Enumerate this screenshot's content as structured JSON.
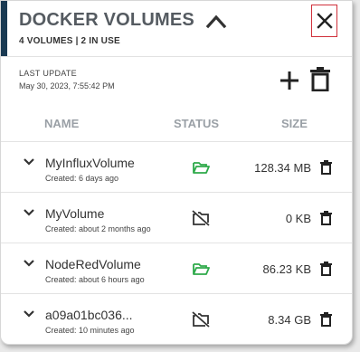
{
  "colors": {
    "accent": "#1a3a52",
    "status_available": "#2eaa4a",
    "status_unavailable": "#333333",
    "close_border": "#d0303a"
  },
  "header": {
    "title": "DOCKER VOLUMES",
    "subtitle": "4 VOLUMES | 2 IN USE",
    "collapse_icon": "chevron-up-icon",
    "close_icon": "close-icon"
  },
  "update": {
    "label": "LAST UPDATE",
    "value": "May 30, 2023, 7:55:42 PM"
  },
  "toolbar": {
    "add_icon": "plus-icon",
    "delete_icon": "trash-icon"
  },
  "table": {
    "columns": [
      "NAME",
      "STATUS",
      "SIZE"
    ],
    "rows": [
      {
        "name": "MyInfluxVolume",
        "created": "Created: 6 days ago",
        "status": "folder-open-icon",
        "size": "128.34 MB"
      },
      {
        "name": "MyVolume",
        "created": "Created: about 2 months ago",
        "status": "folder-off-icon",
        "size": "0 KB"
      },
      {
        "name": "NodeRedVolume",
        "created": "Created: about 6 hours ago",
        "status": "folder-open-icon",
        "size": "86.23 KB"
      },
      {
        "name": "a09a01bc036...",
        "created": "Created: 10 minutes ago",
        "status": "folder-off-icon",
        "size": "8.34 GB"
      }
    ]
  }
}
